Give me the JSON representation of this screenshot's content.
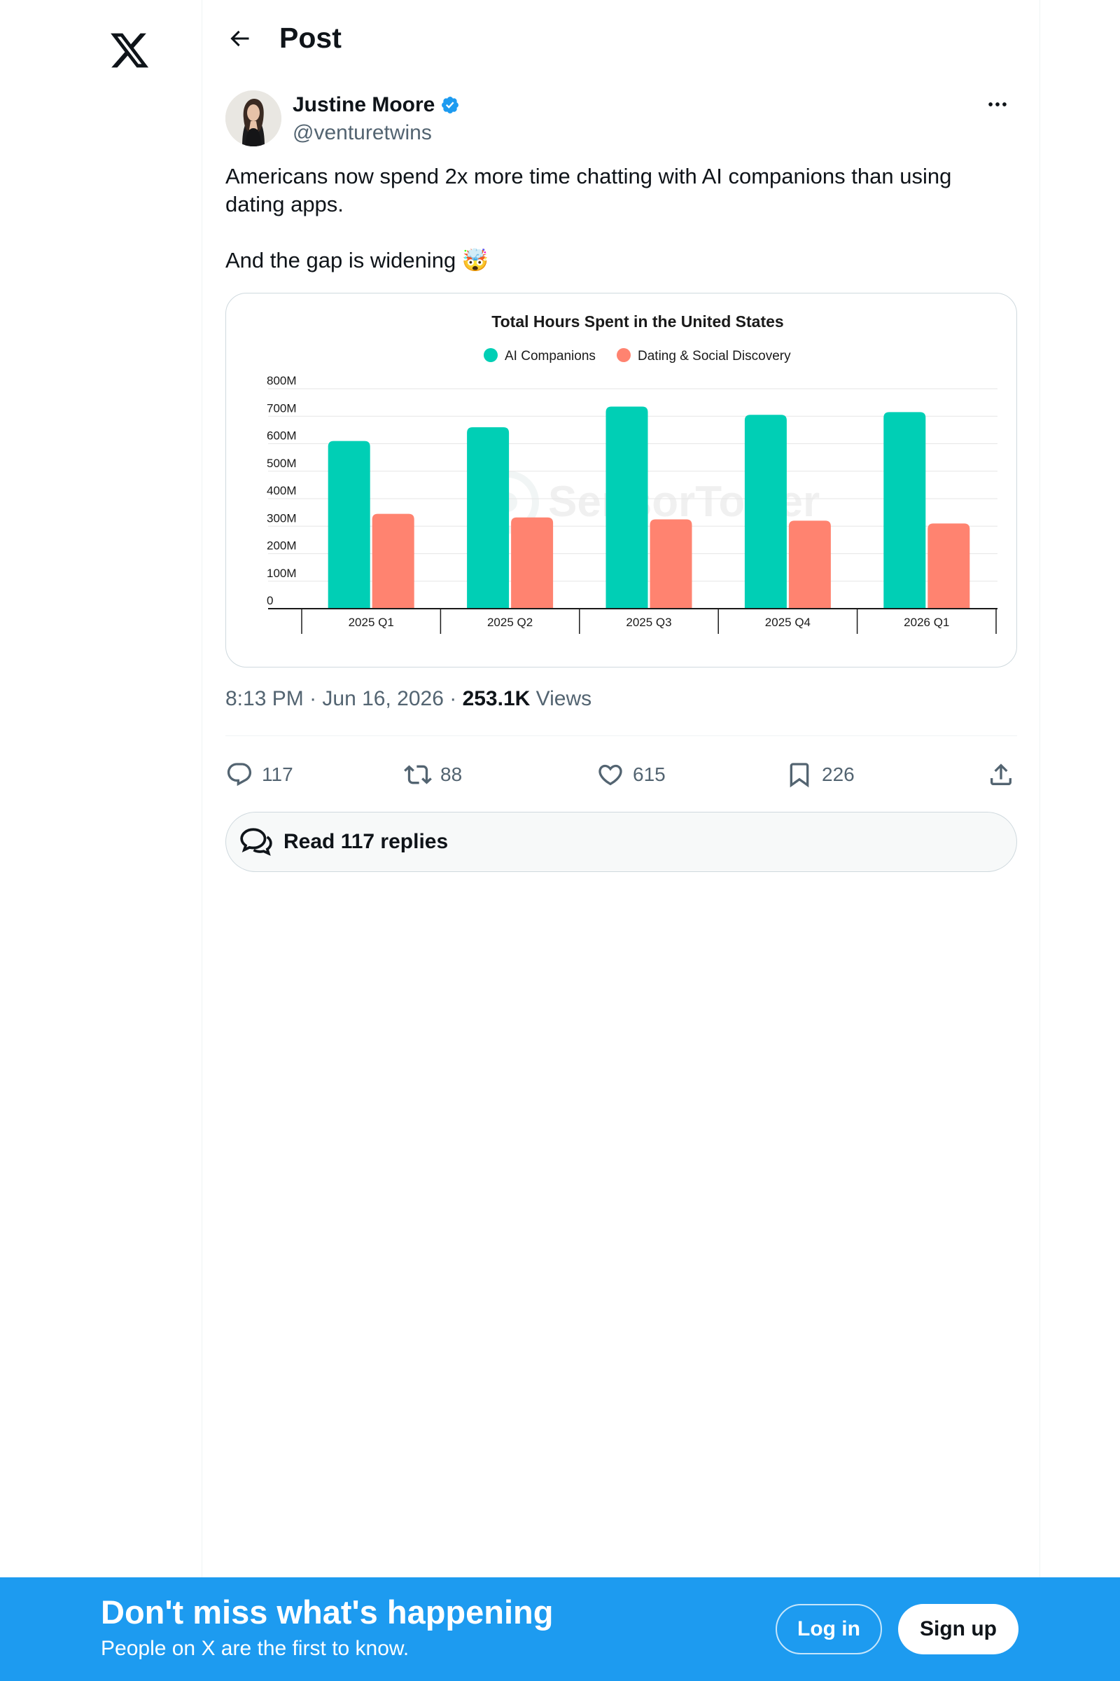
{
  "nav": {
    "logo_icon": "x-logo-icon"
  },
  "header": {
    "title": "Post",
    "back_icon": "arrow-left-icon"
  },
  "post": {
    "author_name": "Justine Moore",
    "author_handle": "@venturetwins",
    "verified_icon": "verified-badge-icon",
    "more_icon": "more-horizontal-icon",
    "text_line1": "Americans now spend 2x more time chatting with AI companions than using dating apps.",
    "text_line2": "And the gap is widening 🤯",
    "time": "8:13 PM",
    "date": "Jun 16, 2026",
    "views_count": "253.1K",
    "views_label": "Views"
  },
  "actions": {
    "replies": "117",
    "reposts": "88",
    "likes": "615",
    "bookmarks": "226",
    "icons": [
      "reply-icon",
      "repost-icon",
      "like-icon",
      "bookmark-icon",
      "share-icon"
    ]
  },
  "read_replies_label": "Read 117 replies",
  "banner": {
    "title": "Don't miss what's happening",
    "subtitle": "People on X are the first to know.",
    "login_label": "Log in",
    "signup_label": "Sign up"
  },
  "colors": {
    "accent": "#1d9bf0",
    "series_ai": "#00cfb5",
    "series_dating": "#ff8370"
  },
  "chart_data": {
    "type": "bar",
    "title": "Total Hours Spent in the United States",
    "categories": [
      "2025 Q1",
      "2025 Q2",
      "2025 Q3",
      "2025 Q4",
      "2026 Q1"
    ],
    "series": [
      {
        "name": "AI Companions",
        "values": [
          610,
          660,
          735,
          705,
          715
        ]
      },
      {
        "name": "Dating & Social Discovery",
        "values": [
          345,
          332,
          325,
          320,
          310
        ]
      }
    ],
    "y_ticks": [
      "0",
      "100M",
      "200M",
      "300M",
      "400M",
      "500M",
      "600M",
      "700M",
      "800M"
    ],
    "ylim": [
      0,
      800
    ],
    "legend_position": "top-center",
    "grid": true,
    "watermark": "SensorTower"
  }
}
